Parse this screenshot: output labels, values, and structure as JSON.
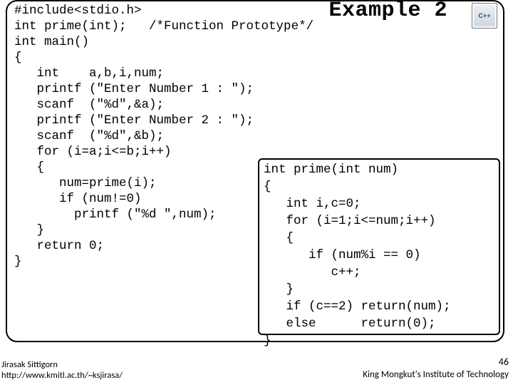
{
  "title": "Example 2",
  "logo": "C++",
  "main_code": "#include<stdio.h>\nint prime(int);   /*Function Prototype*/\nint main()\n{\n   int    a,b,i,num;\n   printf (\"Enter Number 1 : \");\n   scanf  (\"%d\",&a);\n   printf (\"Enter Number 2 : \");\n   scanf  (\"%d\",&b);\n   for (i=a;i<=b;i++)\n   {\n      num=prime(i);\n      if (num!=0)\n        printf (\"%d \",num);\n   }\n   return 0;\n}",
  "inset_code": "int prime(int num)\n{\n   int i,c=0;\n   for (i=1;i<=num;i++)\n   {\n      if (num%i == 0)\n         c++;\n   }\n   if (c==2) return(num);\n   else      return(0);\n}",
  "footer": {
    "author": "Jirasak Sittigorn",
    "url": "http://www.kmitl.ac.th/~ksjirasa/",
    "page": "46",
    "institution": "King Mongkut's Institute of Technology"
  }
}
